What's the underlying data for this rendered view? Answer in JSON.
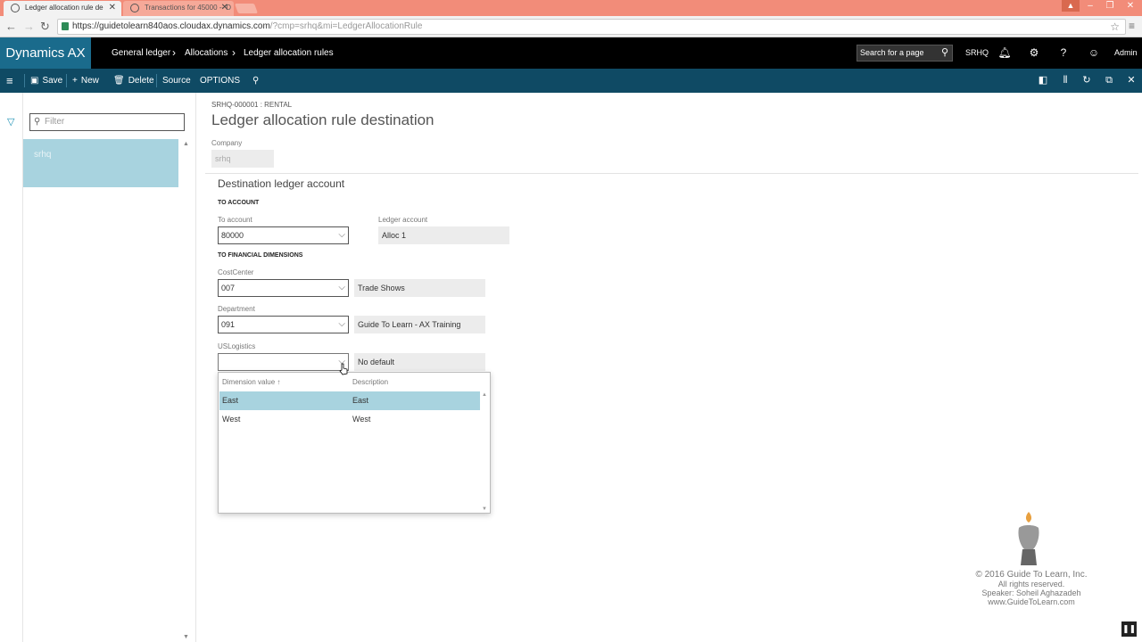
{
  "browser": {
    "tabs": [
      {
        "title": "Ledger allocation rule de",
        "active": true
      },
      {
        "title": "Transactions for 45000 -- D",
        "active": false
      }
    ],
    "url_host": "https://guidetolearn840aos.cloudax.dynamics.com",
    "url_rest": "/?cmp=srhq&mi=LedgerAllocationRule"
  },
  "nav": {
    "brand": "Dynamics AX",
    "breadcrumbs": [
      "General ledger",
      "Allocations",
      "Ledger allocation rules"
    ],
    "search_placeholder": "Search for a page",
    "company": "SRHQ",
    "user": "Admin"
  },
  "actions": {
    "save": "Save",
    "new": "New",
    "delete": "Delete",
    "source": "Source",
    "options": "OPTIONS"
  },
  "list": {
    "filter_placeholder": "Filter",
    "items": [
      "srhq"
    ]
  },
  "form": {
    "caption": "SRHQ-000001 : RENTAL",
    "title": "Ledger allocation rule destination",
    "company_label": "Company",
    "company_value": "srhq",
    "section_title": "Destination ledger account",
    "to_account_group": "TO ACCOUNT",
    "to_account_label": "To account",
    "to_account_value": "80000",
    "ledger_account_label": "Ledger account",
    "ledger_account_value": "Alloc 1",
    "fin_dims_group": "TO FINANCIAL DIMENSIONS",
    "dimensions": [
      {
        "label": "CostCenter",
        "value": "007",
        "description": "Trade Shows"
      },
      {
        "label": "Department",
        "value": "091",
        "description": "Guide To Learn - AX Training"
      },
      {
        "label": "USLogistics",
        "value": "",
        "description": "No default"
      }
    ]
  },
  "lookup": {
    "col_value": "Dimension value",
    "col_desc": "Description",
    "sort_indicator": "↑",
    "rows": [
      {
        "value": "East",
        "description": "East",
        "selected": true
      },
      {
        "value": "West",
        "description": "West",
        "selected": false
      }
    ]
  },
  "watermark": {
    "line1": "© 2016 Guide To Learn, Inc.",
    "line2": "All rights reserved.",
    "line3": "Speaker: Soheil Aghazadeh",
    "line4": "www.GuideToLearn.com"
  },
  "colors": {
    "brand": "#1a6b8c",
    "action_pane": "#0f4a64",
    "selection": "#a8d3df"
  }
}
